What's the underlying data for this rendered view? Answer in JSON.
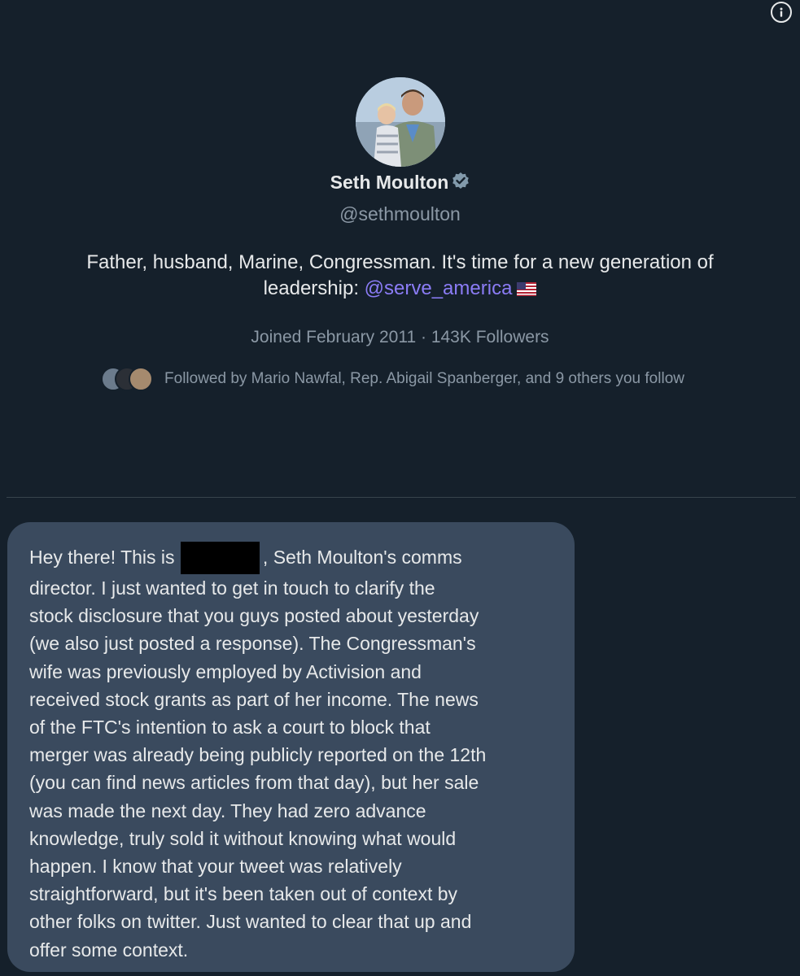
{
  "profile": {
    "name": "Seth Moulton",
    "handle": "@sethmoulton",
    "bio_text": "Father, husband, Marine, Congressman. It's time for a new generation of leadership: ",
    "bio_mention": "@serve_america",
    "joined": "Joined February 2011 · 143K Followers",
    "followed_by": "Followed by Mario Nawfal, Rep. Abigail Spanberger, and 9 others you follow",
    "verified_icon": "verified-badge-icon",
    "flag_icon": "us-flag-icon"
  },
  "message": {
    "intro": "Hey there! This is ",
    "after_redaction": ", Seth Moulton's comms",
    "lines": [
      "director. I just wanted to get in touch to clarify the",
      "stock disclosure that you guys posted about yesterday",
      "(we also just posted a response). The Congressman's",
      "wife was previously employed by Activision and",
      "received stock grants as part of her income. The news",
      "of the FTC's intention to ask a court to block that",
      "merger was already being publicly reported on the 12th",
      "(you can find news articles from that day), but her sale",
      "was made the next day. They had zero advance",
      "knowledge, truly sold it without knowing what would",
      "happen. I know that your tweet was relatively",
      "straightforward, but it's been taken out of context by",
      "other folks on twitter. Just wanted to clear that up and",
      "offer some context."
    ]
  },
  "colors": {
    "background": "#15202b",
    "bubble": "#3a4a5e",
    "mention": "#8b7cf6",
    "secondary_text": "#8b98a5"
  },
  "icons": {
    "info": "info-icon"
  }
}
